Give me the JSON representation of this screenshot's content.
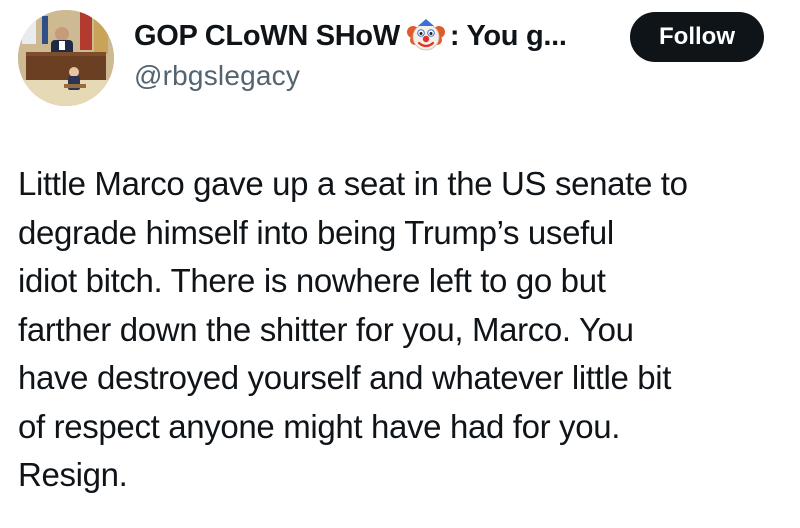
{
  "user": {
    "display_name": "GOP CLoWN SHoW",
    "display_suffix": ": You g...",
    "handle": "@rbgslegacy",
    "name_icon": "clown-face-icon",
    "avatar_icon": "oval-office-photo"
  },
  "follow_button": {
    "label": "Follow"
  },
  "tweet": {
    "lines": [
      "Little Marco gave up a seat in the US senate to",
      "degrade himself into being Trump’s useful",
      "idiot bitch. There is nowhere left to go but",
      "farther down the shitter for you, Marco. You",
      "have destroyed yourself and whatever little bit",
      "of respect anyone might have had for you.",
      "Resign."
    ]
  },
  "colors": {
    "text": "#0f1419",
    "secondary_text": "#536471",
    "button_bg": "#0f1419",
    "button_text": "#ffffff",
    "background": "#ffffff"
  }
}
